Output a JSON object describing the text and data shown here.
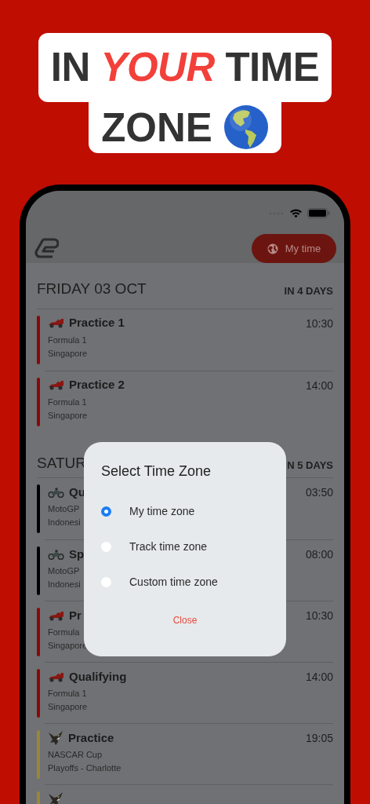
{
  "headline": {
    "line_1": "IN *YOUR* TIME",
    "line_2": "ZONE"
  },
  "header": {
    "button": "My time"
  },
  "days": [
    {
      "title": "FRIDAY 03 OCT",
      "countdown": "IN 4 DAYS",
      "events": [
        {
          "kind": "car",
          "color": "#8a0808",
          "title": "Practice 1",
          "series": "Formula 1",
          "location": "Singapore",
          "time": "10:30"
        },
        {
          "kind": "car",
          "color": "#8a0808",
          "title": "Practice 2",
          "series": "Formula 1",
          "location": "Singapore",
          "time": "14:00"
        }
      ]
    },
    {
      "title": "SATUR",
      "countdown": "N 5 DAYS",
      "events": [
        {
          "kind": "motorbike",
          "color": "#000000",
          "title": "Qu",
          "series": "MotoGP",
          "location": "Indonesi",
          "time": "03:50"
        },
        {
          "kind": "motorbike",
          "color": "#000000",
          "title": "Sp",
          "series": "MotoGP",
          "location": "Indonesi",
          "time": "08:00"
        },
        {
          "kind": "car",
          "color": "#8a0808",
          "title": "Pr",
          "series": "Formula",
          "location": "Singapore",
          "time": "10:30"
        },
        {
          "kind": "car",
          "color": "#8a0808",
          "title": "Qualifying",
          "series": "Formula 1",
          "location": "Singapore",
          "time": "14:00"
        },
        {
          "kind": "eagle",
          "color": "#9c8538",
          "title": "Practice",
          "series": "NASCAR Cup",
          "location": "Playoffs - Charlotte",
          "time": "19:05"
        },
        {
          "kind": "eagle",
          "color": "#9c8538"
        }
      ]
    }
  ],
  "dialog": {
    "title": "Select Time Zone",
    "options": [
      {
        "label": "My time zone",
        "selected": true
      },
      {
        "label": "Track time zone",
        "selected": false
      },
      {
        "label": "Custom time zone",
        "selected": false
      }
    ],
    "close": "Close"
  }
}
